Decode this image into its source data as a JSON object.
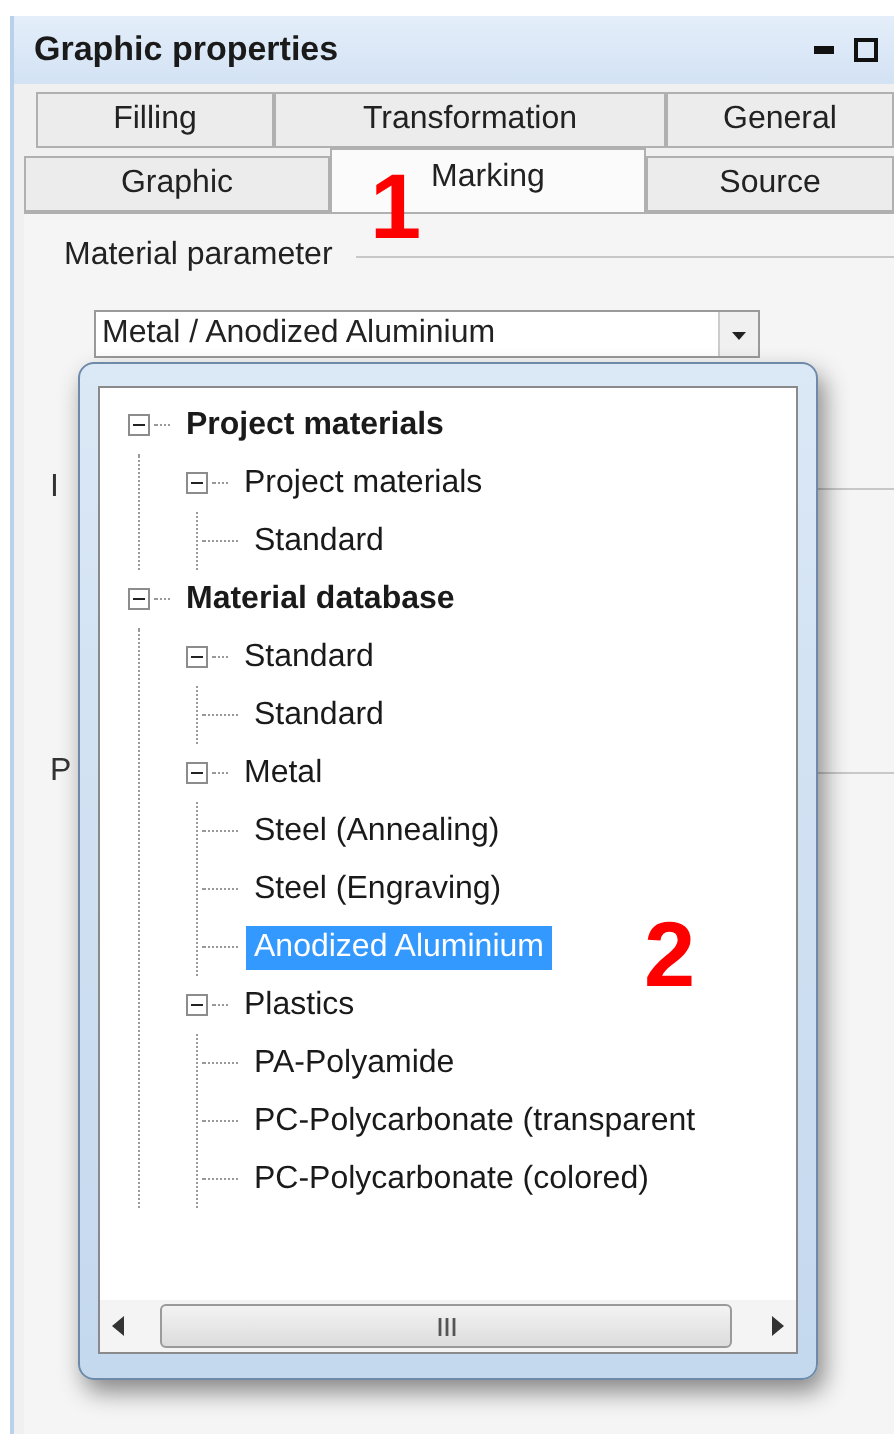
{
  "window": {
    "title": "Graphic properties"
  },
  "tabs_back": [
    {
      "label": "Filling",
      "selected": false
    },
    {
      "label": "Transformation",
      "selected": false
    },
    {
      "label": "General",
      "selected": false
    }
  ],
  "tabs_front": [
    {
      "label": "Graphic",
      "selected": false
    },
    {
      "label": "Marking",
      "selected": true
    },
    {
      "label": "Source",
      "selected": false
    }
  ],
  "section": {
    "title": "Material parameter",
    "dropdown_value": "Metal / Anodized Aluminium"
  },
  "partial_labels": [
    "I",
    "P"
  ],
  "tree": [
    {
      "label": "Project materials",
      "expanded": true,
      "selected": false,
      "children": [
        {
          "label": "Project materials",
          "expanded": true,
          "selected": false,
          "children": [
            {
              "label": "Standard",
              "selected": false
            }
          ]
        }
      ]
    },
    {
      "label": "Material database",
      "expanded": true,
      "selected": false,
      "children": [
        {
          "label": "Standard",
          "expanded": true,
          "selected": false,
          "children": [
            {
              "label": "Standard",
              "selected": false
            }
          ]
        },
        {
          "label": "Metal",
          "expanded": true,
          "selected": false,
          "children": [
            {
              "label": "Steel (Annealing)",
              "selected": false
            },
            {
              "label": "Steel (Engraving)",
              "selected": false
            },
            {
              "label": "Anodized Aluminium",
              "selected": true
            }
          ]
        },
        {
          "label": "Plastics",
          "expanded": true,
          "selected": false,
          "children": [
            {
              "label": "PA-Polyamide",
              "selected": false
            },
            {
              "label": "PC-Polycarbonate (transparent",
              "selected": false
            },
            {
              "label": "PC-Polycarbonate (colored)",
              "selected": false
            }
          ]
        }
      ]
    }
  ],
  "annotations": [
    {
      "text": "1"
    },
    {
      "text": "2"
    }
  ]
}
